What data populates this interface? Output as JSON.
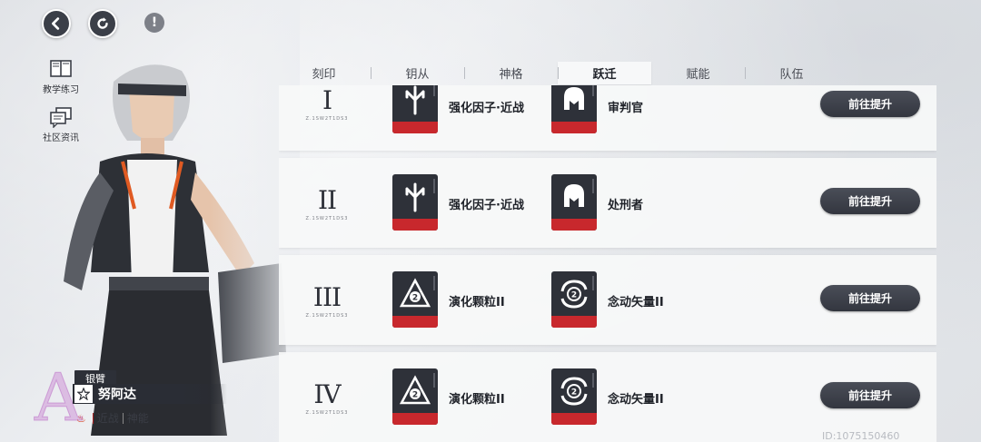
{
  "header": {
    "back_icon": "back-arrow-icon",
    "refresh_icon": "refresh-icon",
    "info_label": "!"
  },
  "side_links": [
    {
      "label": "教学练习",
      "icon": "book-icon"
    },
    {
      "label": "社区资讯",
      "icon": "chat-icon"
    }
  ],
  "character": {
    "rank_letter": "A",
    "subtitle": "银臂",
    "name": "努阿达",
    "roles": [
      "近战",
      "神能"
    ]
  },
  "tabs": [
    {
      "label": "刻印",
      "active": false
    },
    {
      "label": "钥从",
      "active": false
    },
    {
      "label": "神格",
      "active": false
    },
    {
      "label": "跃迁",
      "active": true
    },
    {
      "label": "赋能",
      "active": false
    },
    {
      "label": "队伍",
      "active": false
    }
  ],
  "rows": [
    {
      "numeral": "I",
      "sub": "Z.1SW2T1DS3",
      "item1": {
        "name": "强化因子·近战",
        "icon": "trident-icon"
      },
      "item2": {
        "name": "审判官",
        "icon": "helmet-icon"
      },
      "button": "前往提升"
    },
    {
      "numeral": "II",
      "sub": "Z.1SW2T1DS3",
      "item1": {
        "name": "强化因子·近战",
        "icon": "trident-icon"
      },
      "item2": {
        "name": "处刑者",
        "icon": "helmet-icon"
      },
      "button": "前往提升"
    },
    {
      "numeral": "III",
      "sub": "Z.1SW2T1DS3",
      "item1": {
        "name": "演化颗粒II",
        "icon": "triangle-2-icon"
      },
      "item2": {
        "name": "念动矢量II",
        "icon": "swirl-2-icon"
      },
      "button": "前往提升"
    },
    {
      "numeral": "IV",
      "sub": "Z.1SW2T1DS3",
      "item1": {
        "name": "演化颗粒II",
        "icon": "triangle-2-icon"
      },
      "item2": {
        "name": "念动矢量II",
        "icon": "swirl-2-icon"
      },
      "button": "前往提升"
    }
  ],
  "uid": "ID:1075150460",
  "colors": {
    "accent_red": "#c8282d",
    "button_dark": "#3b3f48"
  }
}
